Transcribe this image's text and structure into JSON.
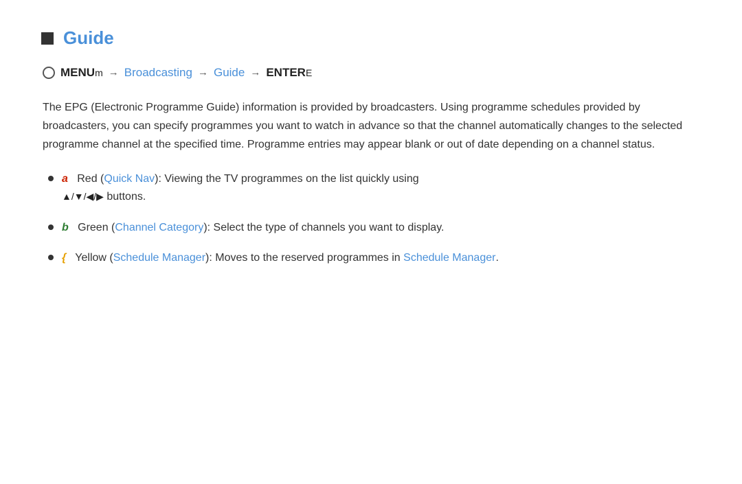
{
  "section": {
    "title": "Guide",
    "menu_path": {
      "circle_label": "O",
      "menu_item": "MENU",
      "menu_suffix": "m",
      "arrow": "→",
      "broadcasting": "Broadcasting",
      "guide": "Guide",
      "enter": "ENTER",
      "enter_suffix": "E"
    },
    "description": "The EPG (Electronic Programme Guide) information is provided by broadcasters. Using programme schedules provided by broadcasters, you can specify programmes you want to watch in advance so that the channel automatically changes to the selected programme channel at the specified time. Programme entries may appear blank or out of date depending on a channel status.",
    "bullets": [
      {
        "color_letter": "a",
        "color_name": "Red",
        "link_text": "Quick Nav",
        "text_after": ": Viewing the TV programmes on the list quickly using",
        "nav_arrows": "▲/▼/◀/▶",
        "text_end": " buttons.",
        "color_class": "color-red"
      },
      {
        "color_letter": "b",
        "color_name": "Green",
        "link_text": "Channel Category",
        "text_after": ": Select the type of channels you want to display.",
        "nav_arrows": "",
        "text_end": "",
        "color_class": "color-green"
      },
      {
        "color_letter": "{",
        "color_name": "Yellow",
        "link_text": "Schedule Manager",
        "text_after": ": Moves to the reserved programmes in",
        "link_text2": "Schedule Manager",
        "text_end": ".",
        "nav_arrows": "",
        "color_class": "color-yellow"
      }
    ]
  }
}
